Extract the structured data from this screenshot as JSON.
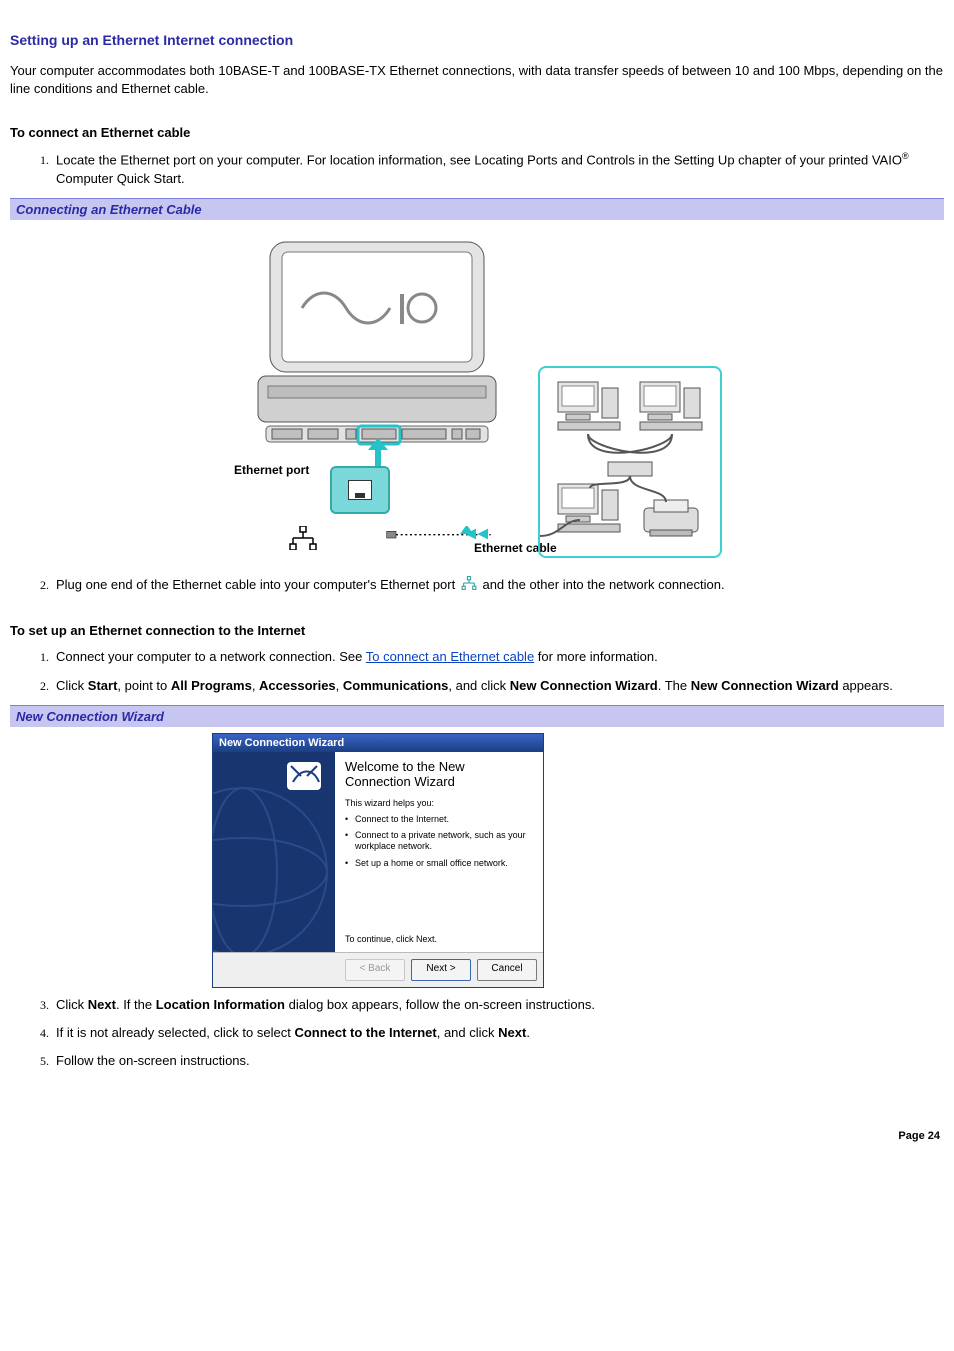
{
  "heading": "Setting up an Ethernet Internet connection",
  "intro": "Your computer accommodates both 10BASE-T and 100BASE-TX Ethernet connections, with data transfer speeds of between 10 and 100 Mbps, depending on the line conditions and Ethernet cable.",
  "section1": {
    "subhead": "To connect an Ethernet cable",
    "step1_a": "Locate the Ethernet port on your computer. For location information, see Locating Ports and Controls in the Setting Up chapter of your printed VAIO",
    "step1_reg": "®",
    "step1_b": " Computer Quick Start.",
    "bluebar": "Connecting an Ethernet Cable",
    "fig": {
      "port_label": "Ethernet port",
      "cable_label": "Ethernet cable"
    },
    "step2_a": "Plug one end of the Ethernet cable into your computer's Ethernet port ",
    "step2_b": " and the other into the network connection."
  },
  "section2": {
    "subhead": "To set up an Ethernet connection to the Internet",
    "step1_a": "Connect your computer to a network connection. See ",
    "step1_link": "To connect an Ethernet cable",
    "step1_b": " for more information.",
    "step2_a": "Click ",
    "step2_start": "Start",
    "step2_b": ", point to ",
    "step2_all_programs": "All Programs",
    "step2_c": ", ",
    "step2_accessories": "Accessories",
    "step2_d": ", ",
    "step2_communications": "Communications",
    "step2_e": ", and click ",
    "step2_ncw": "New Connection Wizard",
    "step2_f": ". The ",
    "step2_ncw2": "New Connection Wizard",
    "step2_g": " appears.",
    "bluebar": "New Connection Wizard",
    "wizard": {
      "title": "New Connection Wizard",
      "welcome": "Welcome to the New Connection Wizard",
      "helps": "This wizard helps you:",
      "b1": "Connect to the Internet.",
      "b2": "Connect to a private network, such as your workplace network.",
      "b3": "Set up a home or small office network.",
      "continue": "To continue, click Next.",
      "back": "< Back",
      "next": "Next >",
      "cancel": "Cancel"
    },
    "step3_a": "Click ",
    "step3_next": "Next",
    "step3_b": ". If the ",
    "step3_loc": "Location Information",
    "step3_c": " dialog box appears, follow the on-screen instructions.",
    "step4_a": "If it is not already selected, click to select ",
    "step4_connect": "Connect to the Internet",
    "step4_b": ", and click ",
    "step4_next": "Next",
    "step4_c": ".",
    "step5": "Follow the on-screen instructions."
  },
  "page_number": "Page 24"
}
